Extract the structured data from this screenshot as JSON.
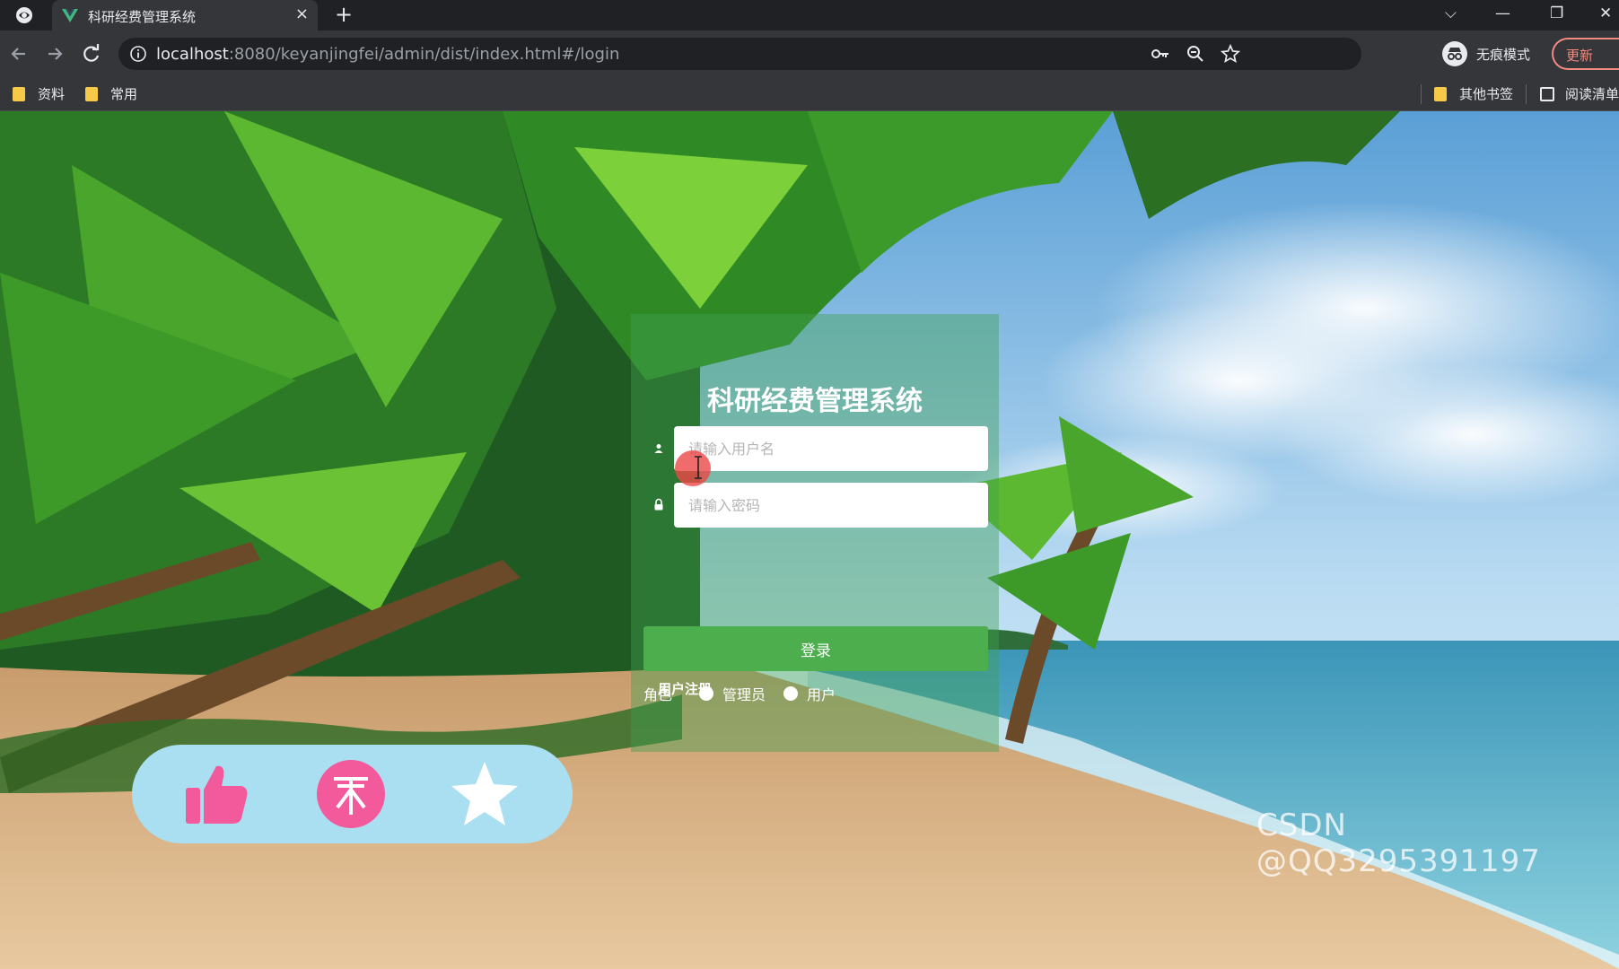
{
  "browser": {
    "tab_title": "科研经费管理系统",
    "tab_close": "×",
    "new_tab": "+",
    "url_host": "localhost",
    "url_rest": ":8080/keyanjingfei/admin/dist/index.html#/login",
    "profile_label": "无痕模式",
    "update_label": "更新",
    "window_controls": {
      "dropdown": "⌵",
      "minimize": "—",
      "restore": "❐",
      "close": "✕"
    }
  },
  "bookmarks": {
    "left": [
      "资料",
      "常用"
    ],
    "other": "其他书签",
    "reading_list": "阅读清单"
  },
  "login": {
    "title": "科研经费管理系统",
    "username_placeholder": "请输入用户名",
    "password_placeholder": "请输入密码",
    "role_label": "角色",
    "role_options": [
      "管理员",
      "用户"
    ],
    "submit_label": "登录",
    "register_link": "用户注册"
  },
  "reactions": {
    "icons": [
      "thumbs-up-icon",
      "coin-icon",
      "star-icon"
    ],
    "colors": {
      "bar": "#a9dff0",
      "icon": "#f25a9c"
    }
  },
  "watermark": "CSDN @QQ3295391197"
}
